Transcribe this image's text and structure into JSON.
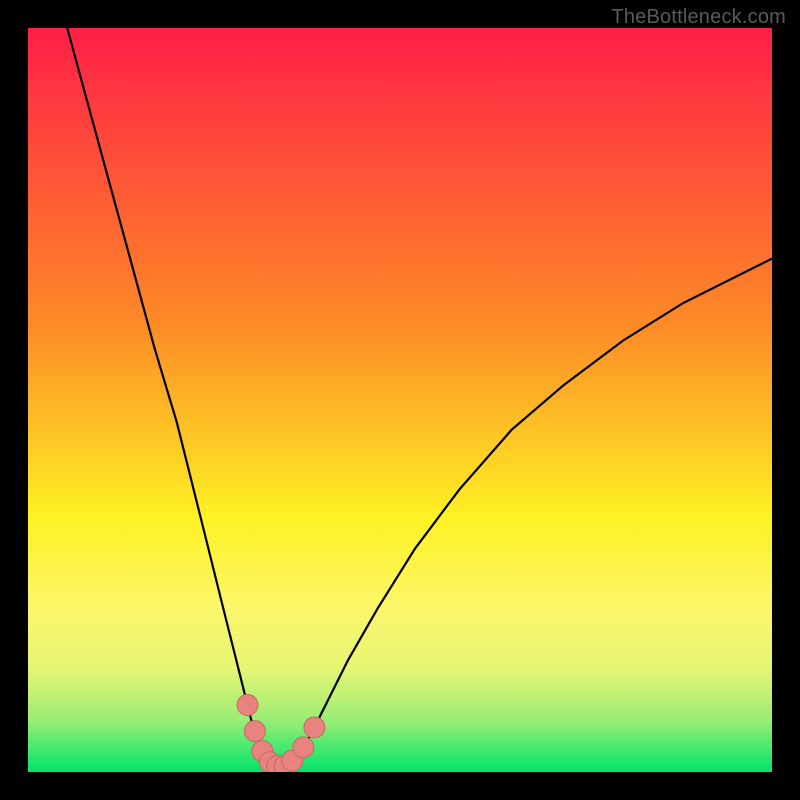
{
  "watermark": "TheBottleneck.com",
  "colors": {
    "frame": "#000000",
    "curve_stroke": "#000000",
    "marker_fill": "#e8837f",
    "marker_stroke": "#c96762",
    "green": "#00e46a",
    "yellow": "#fef224",
    "orange": "#fd8b26",
    "red": "#ff1f47"
  },
  "chart_data": {
    "type": "line",
    "title": "",
    "xlabel": "",
    "ylabel": "",
    "xlim": [
      0,
      100
    ],
    "ylim": [
      0,
      100
    ],
    "series": [
      {
        "name": "bottleneck-curve",
        "x": [
          0,
          2,
          5,
          8,
          11,
          14,
          17,
          20,
          22,
          24,
          26,
          27.5,
          29,
          30,
          31,
          32,
          33,
          34,
          35,
          36.5,
          38,
          40,
          43,
          47,
          52,
          58,
          65,
          72,
          80,
          88,
          96,
          100
        ],
        "y": [
          120,
          112,
          101,
          90,
          79,
          68,
          57,
          47,
          39,
          31,
          23,
          17,
          11,
          7,
          3.5,
          1.5,
          0.5,
          0.5,
          1,
          2.5,
          5,
          9,
          15,
          22,
          30,
          38,
          46,
          52,
          58,
          63,
          67,
          69
        ]
      }
    ],
    "markers": {
      "name": "highlighted-points",
      "x": [
        29.5,
        30.5,
        31.5,
        32.5,
        33.5,
        34.5,
        35.5,
        37,
        38.5
      ],
      "y": [
        9,
        5.5,
        2.8,
        1.3,
        0.8,
        0.8,
        1.5,
        3.3,
        6
      ]
    },
    "gradient_stops": [
      {
        "offset": 0.0,
        "color": "#ff1f47"
      },
      {
        "offset": 0.4,
        "color": "#fd8b26"
      },
      {
        "offset": 0.66,
        "color": "#fef224"
      },
      {
        "offset": 0.78,
        "color": "#fbf66a"
      },
      {
        "offset": 0.86,
        "color": "#e7f574"
      },
      {
        "offset": 0.93,
        "color": "#9aed74"
      },
      {
        "offset": 1.0,
        "color": "#00e46a"
      }
    ]
  }
}
